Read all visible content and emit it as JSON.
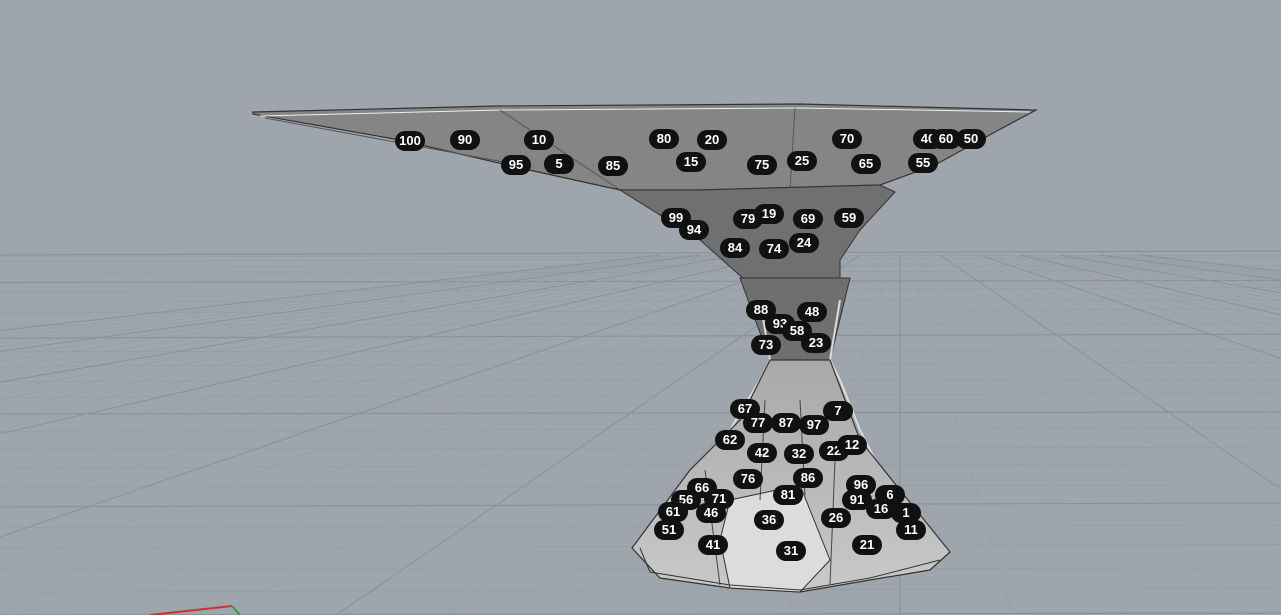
{
  "viewport": {
    "background": "#9ea5ad",
    "grid_color": "#8a9097",
    "grid_minor_color": "#959ba2",
    "model_color": "#7d7d7d"
  },
  "axis": {
    "x_color": "#c83232",
    "y_color": "#32a032"
  },
  "labels": [
    "100",
    "90",
    "10",
    "80",
    "20",
    "70",
    "40",
    "60",
    "50",
    "95",
    "5",
    "85",
    "15",
    "75",
    "25",
    "65",
    "55",
    "99",
    "94",
    "79",
    "19",
    "69",
    "59",
    "84",
    "74",
    "24",
    "88",
    "48",
    "93",
    "58",
    "73",
    "23",
    "67",
    "77",
    "87",
    "97",
    "7",
    "62",
    "42",
    "32",
    "22",
    "12",
    "76",
    "86",
    "66",
    "71",
    "56",
    "81",
    "96",
    "91",
    "6",
    "61",
    "46",
    "16",
    "1",
    "36",
    "26",
    "51",
    "11",
    "41",
    "31",
    "21"
  ]
}
